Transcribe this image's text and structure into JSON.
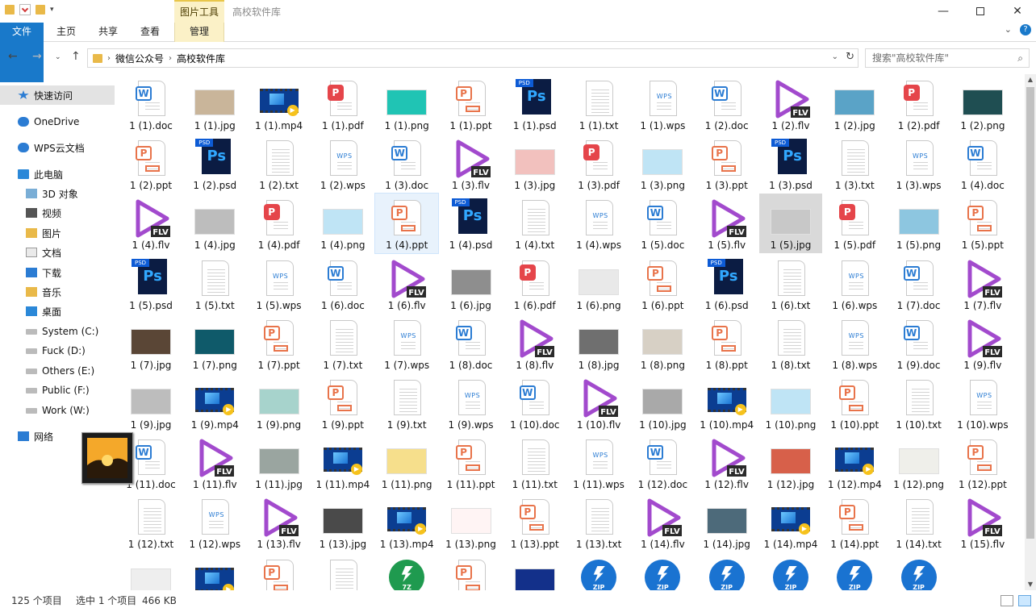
{
  "window": {
    "title": "高校软件库",
    "context_tab": "图片工具",
    "controls": [
      "minimize",
      "maximize",
      "close"
    ]
  },
  "ribbon": {
    "tabs": [
      "文件",
      "主页",
      "共享",
      "查看",
      "管理"
    ]
  },
  "address": {
    "segments": [
      "微信公众号",
      "高校软件库"
    ],
    "search_placeholder": "搜索\"高校软件库\""
  },
  "nav_pane": {
    "items": [
      {
        "label": "快速访问",
        "icon": "star-icon",
        "selected": true
      },
      {
        "label": "OneDrive",
        "icon": "cloud-icon"
      },
      {
        "label": "WPS云文档",
        "icon": "cloud-icon"
      },
      {
        "label": "此电脑",
        "icon": "computer-icon"
      },
      {
        "label": "3D 对象",
        "icon": "3d-icon"
      },
      {
        "label": "视频",
        "icon": "video-icon"
      },
      {
        "label": "图片",
        "icon": "picture-icon"
      },
      {
        "label": "文档",
        "icon": "document-icon"
      },
      {
        "label": "下载",
        "icon": "download-icon"
      },
      {
        "label": "音乐",
        "icon": "music-icon"
      },
      {
        "label": "桌面",
        "icon": "desktop-icon"
      },
      {
        "label": "System (C:)",
        "icon": "drive-icon"
      },
      {
        "label": "Fuck (D:)",
        "icon": "drive-icon"
      },
      {
        "label": "Others (E:)",
        "icon": "drive-icon"
      },
      {
        "label": "Public (F:)",
        "icon": "drive-icon"
      },
      {
        "label": "Work (W:)",
        "icon": "drive-icon"
      },
      {
        "label": "网络",
        "icon": "network-icon"
      }
    ]
  },
  "files": [
    {
      "name": "1 (1).doc",
      "kind": "doc"
    },
    {
      "name": "1 (1).jpg",
      "kind": "jpg",
      "color": "#c9b59a"
    },
    {
      "name": "1 (1).mp4",
      "kind": "mp4"
    },
    {
      "name": "1 (1).pdf",
      "kind": "pdf"
    },
    {
      "name": "1 (1).png",
      "kind": "png",
      "color": "#20c4b4"
    },
    {
      "name": "1 (1).ppt",
      "kind": "ppt"
    },
    {
      "name": "1 (1).psd",
      "kind": "psd"
    },
    {
      "name": "1 (1).txt",
      "kind": "txt"
    },
    {
      "name": "1 (1).wps",
      "kind": "wps"
    },
    {
      "name": "1 (2).doc",
      "kind": "doc"
    },
    {
      "name": "1 (2).flv",
      "kind": "flv"
    },
    {
      "name": "1 (2).jpg",
      "kind": "jpg",
      "color": "#5aa3c7"
    },
    {
      "name": "1 (2).pdf",
      "kind": "pdf"
    },
    {
      "name": "1 (2).png",
      "kind": "png",
      "color": "#1f4e52"
    },
    {
      "name": "1 (2).ppt",
      "kind": "ppt"
    },
    {
      "name": "1 (2).psd",
      "kind": "psd"
    },
    {
      "name": "1 (2).txt",
      "kind": "txt"
    },
    {
      "name": "1 (2).wps",
      "kind": "wps"
    },
    {
      "name": "1 (3).doc",
      "kind": "doc"
    },
    {
      "name": "1 (3).flv",
      "kind": "flv"
    },
    {
      "name": "1 (3).jpg",
      "kind": "jpg",
      "color": "#f2c1be"
    },
    {
      "name": "1 (3).pdf",
      "kind": "pdf"
    },
    {
      "name": "1 (3).png",
      "kind": "png",
      "color": "#bfe4f5"
    },
    {
      "name": "1 (3).ppt",
      "kind": "ppt"
    },
    {
      "name": "1 (3).psd",
      "kind": "psd"
    },
    {
      "name": "1 (3).txt",
      "kind": "txt"
    },
    {
      "name": "1 (3).wps",
      "kind": "wps"
    },
    {
      "name": "1 (4).doc",
      "kind": "doc"
    },
    {
      "name": "1 (4).flv",
      "kind": "flv"
    },
    {
      "name": "1 (4).jpg",
      "kind": "jpg",
      "color": "#bdbdbd"
    },
    {
      "name": "1 (4).pdf",
      "kind": "pdf"
    },
    {
      "name": "1 (4).png",
      "kind": "png",
      "color": "#bfe4f5"
    },
    {
      "name": "1 (4).ppt",
      "kind": "ppt",
      "state": "hover"
    },
    {
      "name": "1 (4).psd",
      "kind": "psd"
    },
    {
      "name": "1 (4).txt",
      "kind": "txt"
    },
    {
      "name": "1 (4).wps",
      "kind": "wps"
    },
    {
      "name": "1 (5).doc",
      "kind": "doc"
    },
    {
      "name": "1 (5).flv",
      "kind": "flv"
    },
    {
      "name": "1 (5).jpg",
      "kind": "jpg",
      "color": "#c8c8c8",
      "state": "selected"
    },
    {
      "name": "1 (5).pdf",
      "kind": "pdf"
    },
    {
      "name": "1 (5).png",
      "kind": "png",
      "color": "#8dc6e0"
    },
    {
      "name": "1 (5).ppt",
      "kind": "ppt"
    },
    {
      "name": "1 (5).psd",
      "kind": "psd"
    },
    {
      "name": "1 (5).txt",
      "kind": "txt"
    },
    {
      "name": "1 (5).wps",
      "kind": "wps"
    },
    {
      "name": "1 (6).doc",
      "kind": "doc"
    },
    {
      "name": "1 (6).flv",
      "kind": "flv"
    },
    {
      "name": "1 (6).jpg",
      "kind": "jpg",
      "color": "#8e8e8e"
    },
    {
      "name": "1 (6).pdf",
      "kind": "pdf"
    },
    {
      "name": "1 (6).png",
      "kind": "png",
      "color": "#e9e9e9"
    },
    {
      "name": "1 (6).ppt",
      "kind": "ppt"
    },
    {
      "name": "1 (6).psd",
      "kind": "psd"
    },
    {
      "name": "1 (6).txt",
      "kind": "txt"
    },
    {
      "name": "1 (6).wps",
      "kind": "wps"
    },
    {
      "name": "1 (7).doc",
      "kind": "doc"
    },
    {
      "name": "1 (7).flv",
      "kind": "flv"
    },
    {
      "name": "1 (7).jpg",
      "kind": "jpg",
      "color": "#5a4636"
    },
    {
      "name": "1 (7).png",
      "kind": "png",
      "color": "#0f5a6a"
    },
    {
      "name": "1 (7).ppt",
      "kind": "ppt"
    },
    {
      "name": "1 (7).txt",
      "kind": "txt"
    },
    {
      "name": "1 (7).wps",
      "kind": "wps"
    },
    {
      "name": "1 (8).doc",
      "kind": "doc"
    },
    {
      "name": "1 (8).flv",
      "kind": "flv"
    },
    {
      "name": "1 (8).jpg",
      "kind": "jpg",
      "color": "#6f6f6f"
    },
    {
      "name": "1 (8).png",
      "kind": "png",
      "color": "#d7d0c5"
    },
    {
      "name": "1 (8).ppt",
      "kind": "ppt"
    },
    {
      "name": "1 (8).txt",
      "kind": "txt"
    },
    {
      "name": "1 (8).wps",
      "kind": "wps"
    },
    {
      "name": "1 (9).doc",
      "kind": "doc"
    },
    {
      "name": "1 (9).flv",
      "kind": "flv"
    },
    {
      "name": "1 (9).jpg",
      "kind": "jpg",
      "color": "#bdbdbd"
    },
    {
      "name": "1 (9).mp4",
      "kind": "mp4"
    },
    {
      "name": "1 (9).png",
      "kind": "png",
      "color": "#a7d3cc"
    },
    {
      "name": "1 (9).ppt",
      "kind": "ppt"
    },
    {
      "name": "1 (9).txt",
      "kind": "txt"
    },
    {
      "name": "1 (9).wps",
      "kind": "wps"
    },
    {
      "name": "1 (10).doc",
      "kind": "doc"
    },
    {
      "name": "1 (10).flv",
      "kind": "flv"
    },
    {
      "name": "1 (10).jpg",
      "kind": "jpg",
      "color": "#a9a9a9"
    },
    {
      "name": "1 (10).mp4",
      "kind": "mp4"
    },
    {
      "name": "1 (10).png",
      "kind": "png",
      "color": "#bfe4f5"
    },
    {
      "name": "1 (10).ppt",
      "kind": "ppt"
    },
    {
      "name": "1 (10).txt",
      "kind": "txt"
    },
    {
      "name": "1 (10).wps",
      "kind": "wps"
    },
    {
      "name": "1 (11).doc",
      "kind": "doc"
    },
    {
      "name": "1 (11).flv",
      "kind": "flv"
    },
    {
      "name": "1 (11).jpg",
      "kind": "jpg",
      "color": "#9aa5a0"
    },
    {
      "name": "1 (11).mp4",
      "kind": "mp4"
    },
    {
      "name": "1 (11).png",
      "kind": "png",
      "color": "#f6df8c"
    },
    {
      "name": "1 (11).ppt",
      "kind": "ppt"
    },
    {
      "name": "1 (11).txt",
      "kind": "txt"
    },
    {
      "name": "1 (11).wps",
      "kind": "wps"
    },
    {
      "name": "1 (12).doc",
      "kind": "doc"
    },
    {
      "name": "1 (12).flv",
      "kind": "flv"
    },
    {
      "name": "1 (12).jpg",
      "kind": "jpg",
      "color": "#d7604a"
    },
    {
      "name": "1 (12).mp4",
      "kind": "mp4"
    },
    {
      "name": "1 (12).png",
      "kind": "png",
      "color": "#efefea"
    },
    {
      "name": "1 (12).ppt",
      "kind": "ppt"
    },
    {
      "name": "1 (12).txt",
      "kind": "txt"
    },
    {
      "name": "1 (12).wps",
      "kind": "wps"
    },
    {
      "name": "1 (13).flv",
      "kind": "flv"
    },
    {
      "name": "1 (13).jpg",
      "kind": "jpg",
      "color": "#4a4a4a"
    },
    {
      "name": "1 (13).mp4",
      "kind": "mp4"
    },
    {
      "name": "1 (13).png",
      "kind": "png",
      "color": "#fff4f4"
    },
    {
      "name": "1 (13).ppt",
      "kind": "ppt"
    },
    {
      "name": "1 (13).txt",
      "kind": "txt"
    },
    {
      "name": "1 (14).flv",
      "kind": "flv"
    },
    {
      "name": "1 (14).jpg",
      "kind": "jpg",
      "color": "#4d6a7a"
    },
    {
      "name": "1 (14).mp4",
      "kind": "mp4"
    },
    {
      "name": "1 (14).ppt",
      "kind": "ppt"
    },
    {
      "name": "1 (14).txt",
      "kind": "txt"
    },
    {
      "name": "1 (15).flv",
      "kind": "flv"
    },
    {
      "name": "",
      "kind": "jpg",
      "color": "#eeeeee"
    },
    {
      "name": "",
      "kind": "mp4"
    },
    {
      "name": "",
      "kind": "ppt"
    },
    {
      "name": "",
      "kind": "txt"
    },
    {
      "name": "",
      "kind": "z7"
    },
    {
      "name": "",
      "kind": "ppt"
    },
    {
      "name": "",
      "kind": "jpg",
      "color": "#13308a"
    },
    {
      "name": "",
      "kind": "zip"
    },
    {
      "name": "",
      "kind": "zip"
    },
    {
      "name": "",
      "kind": "zip"
    },
    {
      "name": "",
      "kind": "zip"
    },
    {
      "name": "",
      "kind": "zip"
    },
    {
      "name": "",
      "kind": "zip"
    }
  ],
  "status": {
    "count": "125 个项目",
    "selection": "选中 1 个项目",
    "size": "466 KB"
  },
  "colors": {
    "accent": "#1979ca",
    "selection": "#cce8ff",
    "context_tab": "#fbf1c7",
    "word": "#2b7cd3",
    "ppt": "#e8734a",
    "pdf": "#e5454a",
    "psd": "#0b1c43",
    "flv": "#a24acd"
  }
}
